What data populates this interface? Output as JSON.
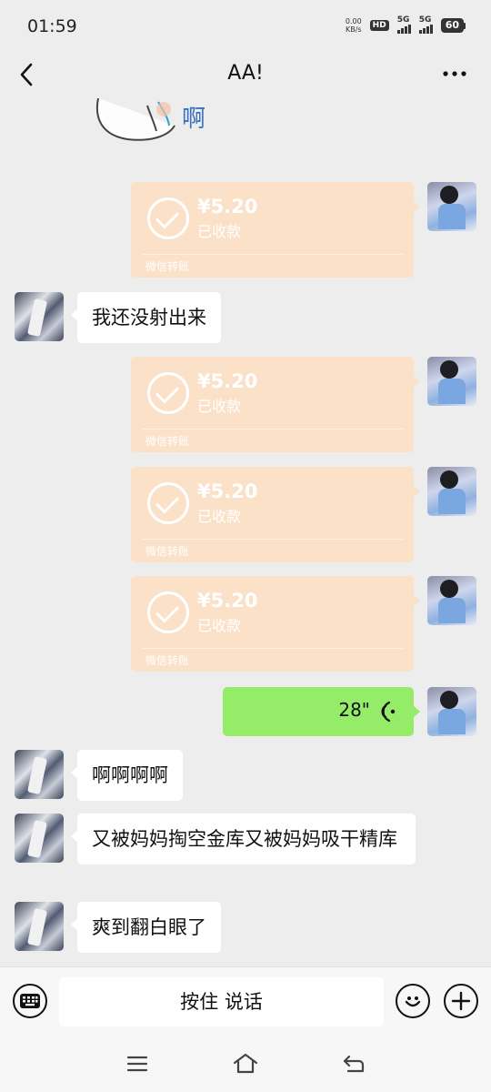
{
  "status_bar": {
    "time": "01:59",
    "net_speed_value": "0.00",
    "net_speed_unit": "KB/s",
    "hd_label": "HD",
    "signal_1": "5G",
    "signal_2": "5G",
    "battery": "60"
  },
  "header": {
    "title": "AA!",
    "back_icon": "chevron-left-icon",
    "more_icon": "more-dots-icon"
  },
  "sticker": {
    "text": "啊"
  },
  "messages": [
    {
      "id": "m1",
      "side": "self",
      "type": "transfer",
      "amount": "¥5.20",
      "status": "已收款",
      "brand": "微信转账"
    },
    {
      "id": "m2",
      "side": "friend",
      "type": "text",
      "text": "我还没射出来"
    },
    {
      "id": "m3",
      "side": "self",
      "type": "transfer",
      "amount": "¥5.20",
      "status": "已收款",
      "brand": "微信转账"
    },
    {
      "id": "m4",
      "side": "self",
      "type": "transfer",
      "amount": "¥5.20",
      "status": "已收款",
      "brand": "微信转账"
    },
    {
      "id": "m5",
      "side": "self",
      "type": "transfer",
      "amount": "¥5.20",
      "status": "已收款",
      "brand": "微信转账"
    },
    {
      "id": "m6",
      "side": "self",
      "type": "voice",
      "duration": "28\""
    },
    {
      "id": "m7",
      "side": "friend",
      "type": "text",
      "text": "啊啊啊啊"
    },
    {
      "id": "m8",
      "side": "friend",
      "type": "text",
      "text": "又被妈妈掏空金库又被妈妈吸干精库"
    },
    {
      "id": "m9",
      "side": "friend",
      "type": "text",
      "text": "爽到翻白眼了"
    }
  ],
  "input_bar": {
    "hold_to_talk": "按住 说话",
    "keyboard_icon": "keyboard-icon",
    "emoji_icon": "emoji-icon",
    "plus_icon": "plus-icon"
  },
  "system_nav": {
    "menu_icon": "menu-icon",
    "home_icon": "home-icon",
    "back_icon": "back-icon"
  },
  "colors": {
    "background": "#ededed",
    "incoming_bubble": "#ffffff",
    "voice_bubble": "#95ec69",
    "transfer_received": "#fbe1c8"
  }
}
